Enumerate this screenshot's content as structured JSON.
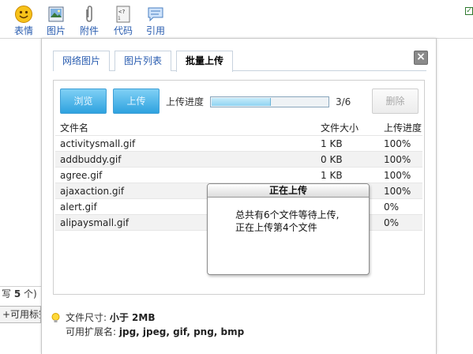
{
  "toolbar": {
    "items": [
      {
        "label": "表情",
        "icon": "smiley-icon"
      },
      {
        "label": "图片",
        "icon": "picture-icon"
      },
      {
        "label": "附件",
        "icon": "paperclip-icon"
      },
      {
        "label": "代码",
        "icon": "code-icon"
      },
      {
        "label": "引用",
        "icon": "quote-icon"
      }
    ]
  },
  "background": {
    "count_prefix": "写",
    "count_num": "5",
    "count_suffix": "个)",
    "tag_bar": "+可用标签"
  },
  "dialog": {
    "tabs": [
      {
        "label": "网络图片",
        "active": false
      },
      {
        "label": "图片列表",
        "active": false
      },
      {
        "label": "批量上传",
        "active": true
      }
    ],
    "close_label": "×",
    "browse_label": "浏览",
    "upload_label": "上传",
    "progress_label": "上传进度",
    "progress_fraction": 0.5,
    "progress_count": "3/6",
    "delete_label": "删除",
    "table": {
      "headers": {
        "name": "文件名",
        "size": "文件大小",
        "progress": "上传进度"
      },
      "rows": [
        {
          "name": "activitysmall.gif",
          "size": "1 KB",
          "progress": "100%"
        },
        {
          "name": "addbuddy.gif",
          "size": "0 KB",
          "progress": "100%"
        },
        {
          "name": "agree.gif",
          "size": "1 KB",
          "progress": "100%"
        },
        {
          "name": "ajaxaction.gif",
          "size": "",
          "progress": "100%"
        },
        {
          "name": "alert.gif",
          "size": "",
          "progress": "0%"
        },
        {
          "name": "alipaysmall.gif",
          "size": "",
          "progress": "0%"
        }
      ]
    },
    "popup": {
      "title": "正在上传",
      "line1": "总共有6个文件等待上传,",
      "line2": "正在上传第4个文件"
    },
    "info": {
      "size_label": "文件尺寸:",
      "size_value": "小于 2MB",
      "ext_label": "可用扩展名:",
      "ext_value": "jpg, jpeg, gif, png, bmp"
    }
  },
  "colors": {
    "link": "#2a5db0",
    "button_blue": "#2ea2df",
    "progress_fill": "#8fd3f2"
  }
}
